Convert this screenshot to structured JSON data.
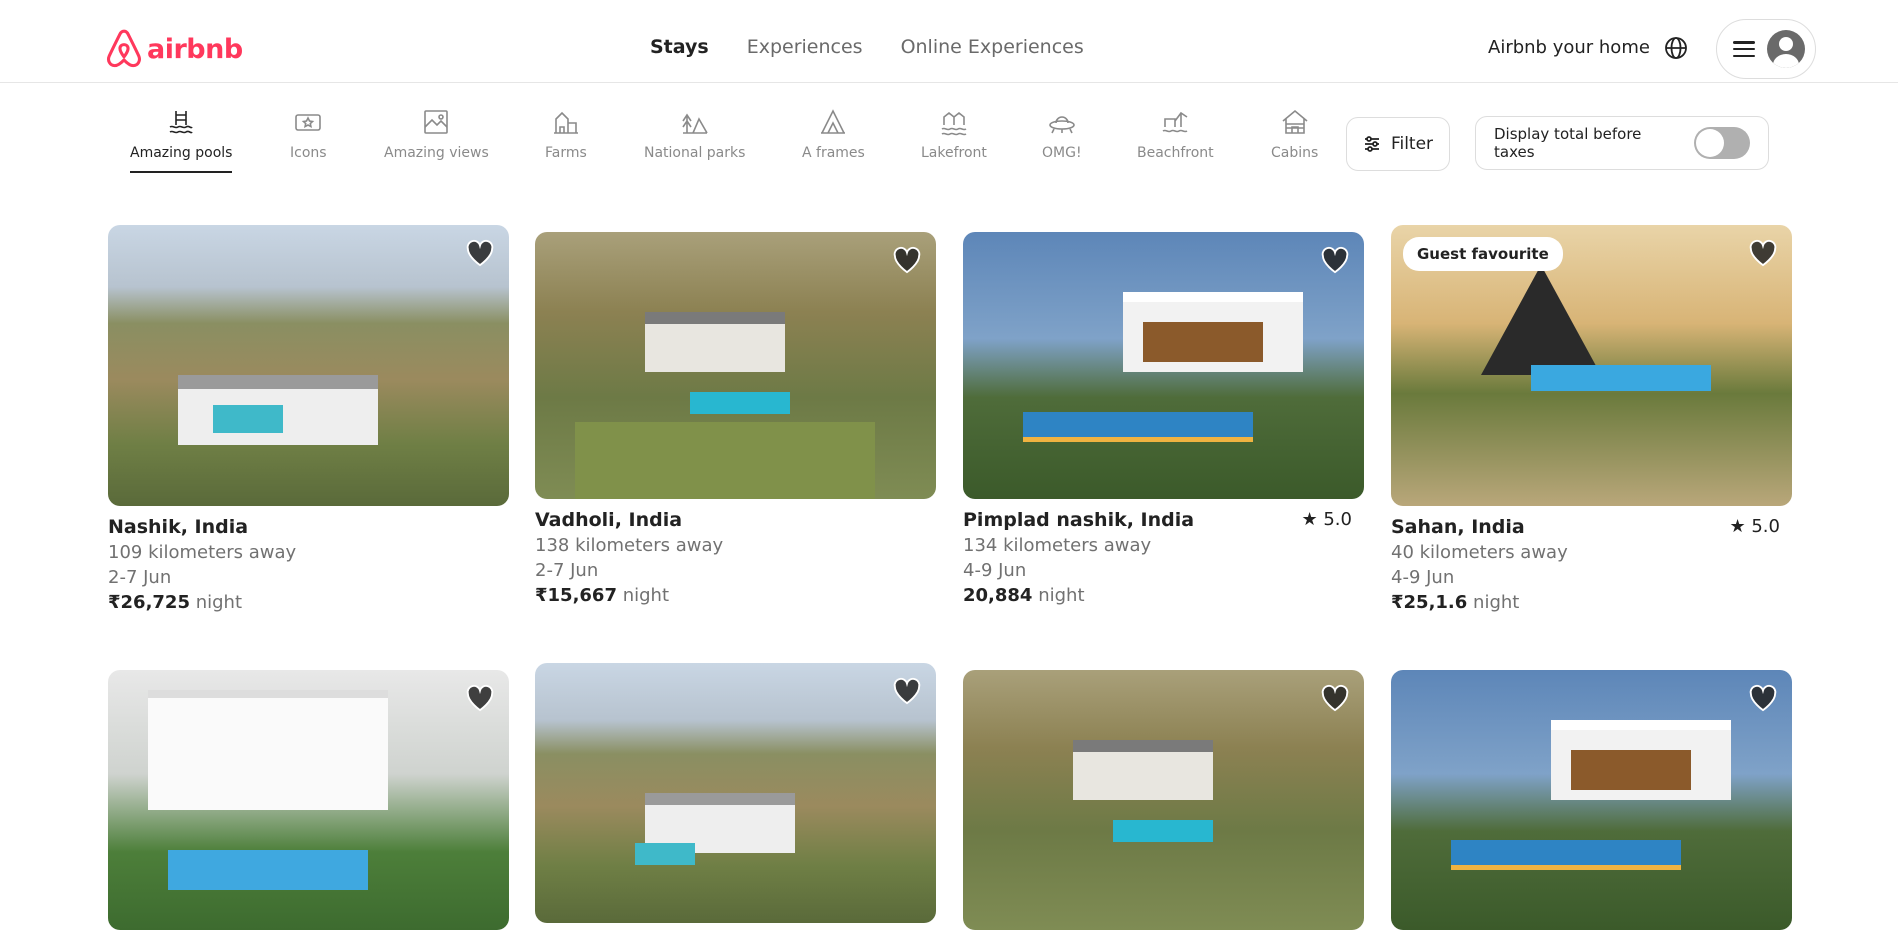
{
  "header": {
    "logo_text": "airbnb",
    "nav": [
      "Stays",
      "Experiences",
      "Online Experiences"
    ],
    "host_link": "Airbnb your home"
  },
  "categories": [
    {
      "label": "Amazing pools",
      "icon": "pool-icon",
      "active": true
    },
    {
      "label": "Icons",
      "icon": "ticket-icon"
    },
    {
      "label": "Amazing views",
      "icon": "view-icon"
    },
    {
      "label": "Farms",
      "icon": "farm-icon"
    },
    {
      "label": "National parks",
      "icon": "park-icon"
    },
    {
      "label": "A frames",
      "icon": "aframe-icon"
    },
    {
      "label": "Lakefront",
      "icon": "lakefront-icon"
    },
    {
      "label": "OMG!",
      "icon": "ufo-icon"
    },
    {
      "label": "Beachfront",
      "icon": "beach-icon"
    },
    {
      "label": "Cabins",
      "icon": "cabin-icon"
    }
  ],
  "filter": {
    "label": "Filter"
  },
  "tax_toggle": {
    "label": "Display total before taxes",
    "on": false
  },
  "listings": [
    {
      "title": "Nashik, India",
      "distance": "109 kilometers away",
      "dates": "2-7 Jun",
      "price": "₹26,725",
      "unit": "night",
      "rating": ""
    },
    {
      "title": "Vadholi, India",
      "distance": "138 kilometers away",
      "dates": "2-7 Jun",
      "price": "₹15,667",
      "unit": "night",
      "rating": ""
    },
    {
      "title": "Pimplad nashik, India",
      "distance": "134 kilometers away",
      "dates": "4-9 Jun",
      "price": "20,884",
      "unit": "night",
      "rating": "5.0"
    },
    {
      "title": "Sahan, India",
      "distance": "40 kilometers away",
      "dates": "4-9 Jun",
      "price": "₹25,1.6",
      "unit": "night",
      "rating": "5.0",
      "badge": "Guest favourite"
    }
  ]
}
